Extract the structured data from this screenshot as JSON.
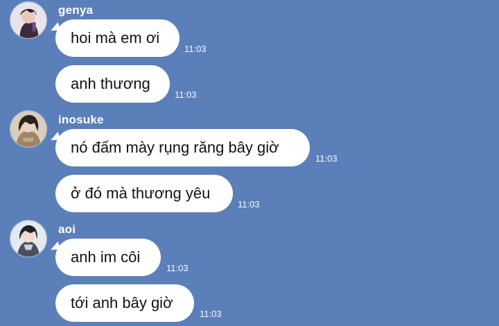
{
  "conversation": {
    "groups": [
      {
        "sender": "genya",
        "avatar_icon": "avatar-genya-icon",
        "messages": [
          {
            "text": "hoi mà em ơi",
            "time": "11:03"
          },
          {
            "text": "anh thương",
            "time": "11:03"
          }
        ]
      },
      {
        "sender": "inosuke",
        "avatar_icon": "avatar-inosuke-icon",
        "messages": [
          {
            "text": "nó đấm mày rụng răng bây giờ",
            "time": "11:03"
          },
          {
            "text": "ở đó mà thương yêu",
            "time": "11:03"
          }
        ]
      },
      {
        "sender": "aoi",
        "avatar_icon": "avatar-aoi-icon",
        "messages": [
          {
            "text": "anh im côi",
            "time": "11:03"
          },
          {
            "text": "tới anh bây giờ",
            "time": "11:03"
          }
        ]
      }
    ]
  },
  "colors": {
    "background": "#5b7fb9",
    "bubble": "#ffffff",
    "text": "#111111",
    "meta_text": "#ffffff"
  }
}
